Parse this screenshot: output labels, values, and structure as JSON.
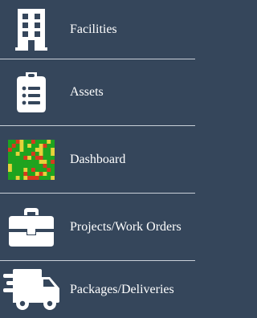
{
  "menu": {
    "items": [
      {
        "label": "Facilities",
        "icon": "building-icon"
      },
      {
        "label": "Assets",
        "icon": "clipboard-list-icon"
      },
      {
        "label": "Dashboard",
        "icon": "heatmap-thumbnail-icon"
      },
      {
        "label": "Projects/Work Orders",
        "icon": "toolbox-icon"
      },
      {
        "label": "Packages/Deliveries",
        "icon": "delivery-truck-icon"
      }
    ]
  },
  "colors": {
    "background": "#35465b",
    "divider": "#c9d0d8",
    "text": "#ffffff",
    "heatmap_green": "#1fa31f",
    "heatmap_red": "#d83a1e",
    "heatmap_yellow": "#e6d23a"
  }
}
